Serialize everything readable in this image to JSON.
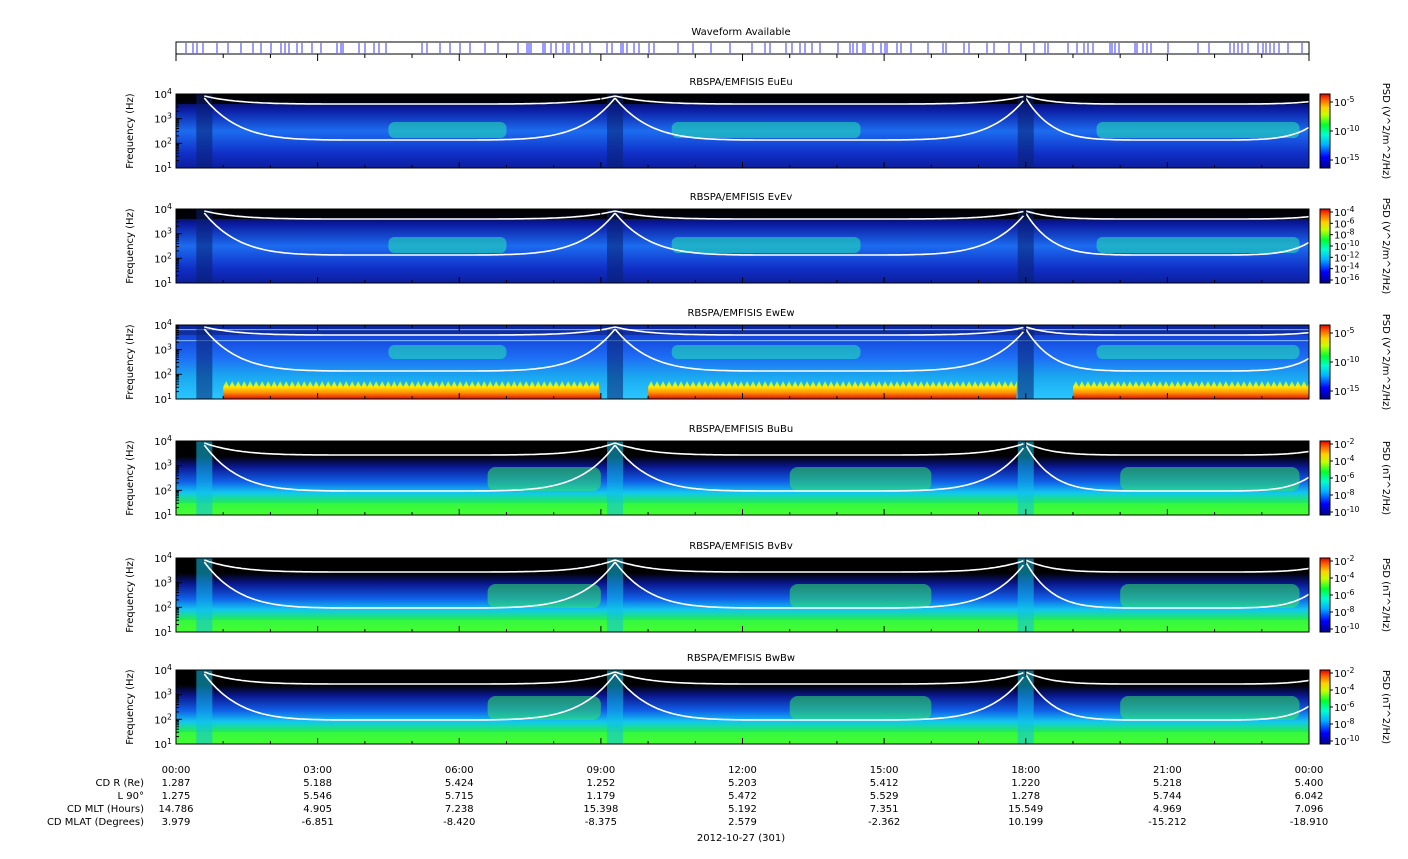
{
  "figure": {
    "waveform_title": "Waveform Available",
    "date_label": "2012-10-27 (301)",
    "colors": {
      "waveform_tick": "#3a3aff",
      "curve": "#ffffff",
      "background": "#000000"
    }
  },
  "chart_data": [
    {
      "type": "heatmap",
      "title": "RBSPA/EMFISIS  EuEu",
      "ylabel": "Frequency (Hz)",
      "yscale": "log",
      "ylim": [
        10,
        10000
      ],
      "ytick_labels": [
        "10^1",
        "10^2",
        "10^3",
        "10^4"
      ],
      "colorbar_label": "PSD (V^2/m^2/Hz)",
      "colorbar_ticks": [
        "10^-5",
        "10^-10",
        "10^-15"
      ]
    },
    {
      "type": "heatmap",
      "title": "RBSPA/EMFISIS  EvEv",
      "ylabel": "Frequency (Hz)",
      "yscale": "log",
      "ylim": [
        10,
        10000
      ],
      "ytick_labels": [
        "10^1",
        "10^2",
        "10^3",
        "10^4"
      ],
      "colorbar_label": "PSD (V^2/m^2/Hz)",
      "colorbar_ticks": [
        "10^-4",
        "10^-6",
        "10^-8",
        "10^-10",
        "10^-12",
        "10^-14",
        "10^-16"
      ]
    },
    {
      "type": "heatmap",
      "title": "RBSPA/EMFISIS  EwEw",
      "ylabel": "Frequency (Hz)",
      "yscale": "log",
      "ylim": [
        10,
        10000
      ],
      "ytick_labels": [
        "10^1",
        "10^2",
        "10^3",
        "10^4"
      ],
      "colorbar_label": "PSD (V^2/m^2/Hz)",
      "colorbar_ticks": [
        "10^-5",
        "10^-10",
        "10^-15"
      ]
    },
    {
      "type": "heatmap",
      "title": "RBSPA/EMFISIS  BuBu",
      "ylabel": "Frequency (Hz)",
      "yscale": "log",
      "ylim": [
        10,
        10000
      ],
      "ytick_labels": [
        "10^1",
        "10^2",
        "10^3",
        "10^4"
      ],
      "colorbar_label": "PSD (nT^2/Hz)",
      "colorbar_ticks": [
        "10^-2",
        "10^-4",
        "10^-6",
        "10^-8",
        "10^-10"
      ]
    },
    {
      "type": "heatmap",
      "title": "RBSPA/EMFISIS  BvBv",
      "ylabel": "Frequency (Hz)",
      "yscale": "log",
      "ylim": [
        10,
        10000
      ],
      "ytick_labels": [
        "10^1",
        "10^2",
        "10^3",
        "10^4"
      ],
      "colorbar_label": "PSD (nT^2/Hz)",
      "colorbar_ticks": [
        "10^-2",
        "10^-4",
        "10^-6",
        "10^-8",
        "10^-10"
      ]
    },
    {
      "type": "heatmap",
      "title": "RBSPA/EMFISIS  BwBw",
      "ylabel": "Frequency (Hz)",
      "yscale": "log",
      "ylim": [
        10,
        10000
      ],
      "ytick_labels": [
        "10^1",
        "10^2",
        "10^3",
        "10^4"
      ],
      "colorbar_label": "PSD (nT^2/Hz)",
      "colorbar_ticks": [
        "10^-2",
        "10^-4",
        "10^-6",
        "10^-8",
        "10^-10"
      ]
    }
  ],
  "xaxis": {
    "tick_labels": [
      "00:00",
      "03:00",
      "06:00",
      "09:00",
      "12:00",
      "15:00",
      "18:00",
      "21:00",
      "00:00"
    ],
    "ephemeris": [
      {
        "label": "CD R (Re)",
        "values": [
          "1.287",
          "5.188",
          "5.424",
          "1.252",
          "5.203",
          "5.412",
          "1.220",
          "5.218",
          "5.400"
        ]
      },
      {
        "label": "L 90°",
        "values": [
          "1.275",
          "5.546",
          "5.715",
          "1.179",
          "5.472",
          "5.529",
          "1.278",
          "5.744",
          "6.042"
        ]
      },
      {
        "label": "CD MLT (Hours)",
        "values": [
          "14.786",
          "4.905",
          "7.238",
          "15.398",
          "5.192",
          "7.351",
          "15.549",
          "4.969",
          "7.096"
        ]
      },
      {
        "label": "CD MLAT (Degrees)",
        "values": [
          "3.979",
          "-6.851",
          "-8.420",
          "-8.375",
          "2.579",
          "-2.362",
          "10.199",
          "-15.212",
          "-18.910"
        ]
      }
    ]
  }
}
